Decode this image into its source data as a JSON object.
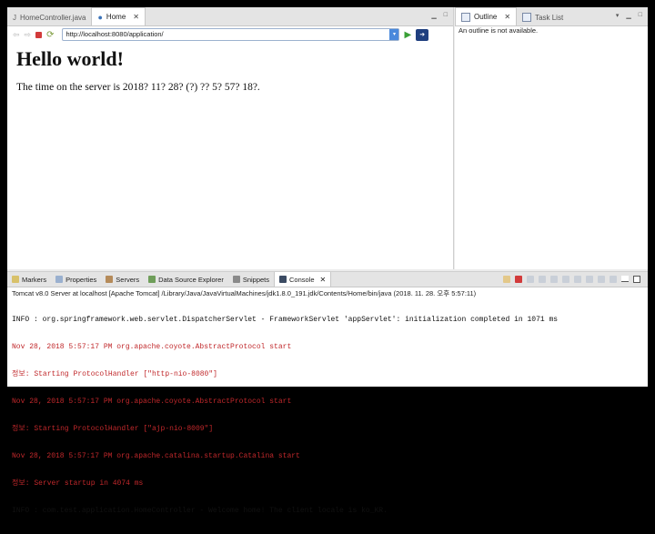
{
  "colors": {
    "error_text": "#c0282b",
    "accent_blue": "#4a89dc",
    "go_green": "#3aa037"
  },
  "editor": {
    "tabs": [
      {
        "label": "HomeController.java",
        "icon": "java-file-icon"
      },
      {
        "label": "Home",
        "icon": "globe-icon"
      }
    ],
    "url": "http://localhost:8080/application/",
    "page": {
      "heading": "Hello world!",
      "body": "The time on the server is 2018? 11? 28? (?) ?? 5? 57? 18?."
    }
  },
  "outline": {
    "tabs": [
      {
        "label": "Outline"
      },
      {
        "label": "Task List"
      }
    ],
    "message": "An outline is not available."
  },
  "console": {
    "tabs": [
      {
        "label": "Markers"
      },
      {
        "label": "Properties"
      },
      {
        "label": "Servers"
      },
      {
        "label": "Data Source Explorer"
      },
      {
        "label": "Snippets"
      },
      {
        "label": "Console"
      }
    ],
    "title": "Tomcat v8.0 Server at localhost [Apache Tomcat] /Library/Java/JavaVirtualMachines/jdk1.8.0_191.jdk/Contents/Home/bin/java (2018. 11. 28. 오후 5:57:11)",
    "lines": [
      {
        "text": "INFO : org.springframework.web.servlet.DispatcherServlet - FrameworkServlet 'appServlet': initialization completed in 1071 ms",
        "type": "info"
      },
      {
        "text": "Nov 28, 2018 5:57:17 PM org.apache.coyote.AbstractProtocol start",
        "type": "err"
      },
      {
        "text": "정보: Starting ProtocolHandler [\"http-nio-8080\"]",
        "type": "err"
      },
      {
        "text": "Nov 28, 2018 5:57:17 PM org.apache.coyote.AbstractProtocol start",
        "type": "err"
      },
      {
        "text": "정보: Starting ProtocolHandler [\"ajp-nio-8009\"]",
        "type": "err"
      },
      {
        "text": "Nov 28, 2018 5:57:17 PM org.apache.catalina.startup.Catalina start",
        "type": "err"
      },
      {
        "text": "정보: Server startup in 4074 ms",
        "type": "err"
      },
      {
        "text": "INFO : com.test.application.HomeController - Welcome home! The client locale is ko_KR.",
        "type": "info"
      }
    ]
  }
}
